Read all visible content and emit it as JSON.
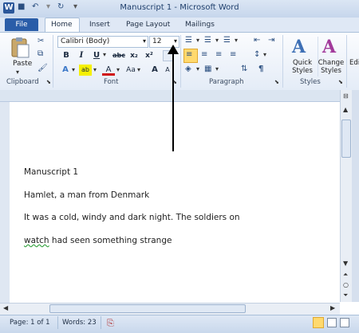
{
  "window": {
    "title": "Manuscript 1  -  Microsoft Word"
  },
  "tabs": [
    {
      "label": "File"
    },
    {
      "label": "Home"
    },
    {
      "label": "Insert"
    },
    {
      "label": "Page Layout"
    },
    {
      "label": "Mailings"
    }
  ],
  "ribbon": {
    "clipboard": {
      "paste_label": "Paste",
      "group_label": "Clipboard"
    },
    "font": {
      "font_name": "Calibri (Body)",
      "font_size": "12",
      "group_label": "Font",
      "bold": "B",
      "italic": "I",
      "underline": "U",
      "strikethrough": "abc",
      "subscript": "x₂",
      "superscript": "x²",
      "grow": "A",
      "change_case": "Aa"
    },
    "paragraph": {
      "group_label": "Paragraph"
    },
    "styles": {
      "quick_styles_label": "Quick Styles",
      "change_styles_label": "Change Styles",
      "group_label": "Styles",
      "editing_label": "Edi"
    }
  },
  "document": {
    "lines": [
      "Manuscript 1",
      "Hamlet, a man from Denmark",
      "It was a cold, windy and dark night. The soldiers on",
      "watch",
      " had seen something strange"
    ]
  },
  "status": {
    "page": "Page: 1 of 1",
    "words": "Words: 23"
  },
  "colors": {
    "file_tab": "#2a5da8",
    "accent_blue": "#2b579a",
    "spell_underline": "#2e9f3a"
  }
}
